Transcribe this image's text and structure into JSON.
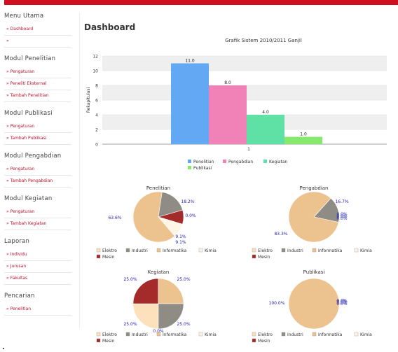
{
  "sidebar": {
    "sections": [
      {
        "title": "Menu Utama",
        "items": [
          "Dashboard",
          ""
        ]
      },
      {
        "title": "Modul Penelitian",
        "items": [
          "Pengaturan",
          "Peneliti Eksternal",
          "Tambah Penelitian"
        ]
      },
      {
        "title": "Modul Publikasi",
        "items": [
          "Pengaturan",
          "Tambah Publikasi"
        ]
      },
      {
        "title": "Modul Pengabdian",
        "items": [
          "Pengaturan",
          "Tambah Pengabdian"
        ]
      },
      {
        "title": "Modul Kegiatan",
        "items": [
          "Pengaturan",
          "Tambah Kegiatan"
        ]
      },
      {
        "title": "Laporan",
        "items": [
          "Individu",
          "Jurusan",
          "Fakultas"
        ]
      },
      {
        "title": "Pencarian",
        "items": [
          "Penelitian"
        ]
      }
    ]
  },
  "page": {
    "title": "Dashboard"
  },
  "colors": {
    "accent": "#d01020",
    "link": "#c0102a"
  },
  "chart_data": [
    {
      "type": "bar",
      "title": "Grafik Sistem 2010/2011 Ganjil",
      "xlabel": "",
      "ylabel": "Rekapitulasi",
      "categories": [
        "1"
      ],
      "ylim": [
        0,
        12
      ],
      "yticks": [
        "0",
        "2",
        "4",
        "6",
        "8",
        "10",
        "12"
      ],
      "series": [
        {
          "name": "Penelitian",
          "values": [
            11.0
          ],
          "label": "11.0",
          "color": "#62a8f2"
        },
        {
          "name": "Pengabdian",
          "values": [
            8.0
          ],
          "label": "8.0",
          "color": "#f082b8"
        },
        {
          "name": "Kegiatan",
          "values": [
            4.0
          ],
          "label": "4.0",
          "color": "#5fe0a4"
        },
        {
          "name": "Publikasi",
          "values": [
            1.0
          ],
          "label": "1.0",
          "color": "#86e86c"
        }
      ],
      "grid": true,
      "legend": "bottom"
    },
    {
      "type": "pie",
      "title": "Penelitian",
      "categories": [
        "Elektro",
        "Industri",
        "Informatika",
        "Kimia",
        "Mesin"
      ],
      "values": [
        0.0,
        18.2,
        63.6,
        9.1,
        9.1
      ],
      "labels": [
        "0.0%",
        "18.2%",
        "63.6%",
        "9.1%",
        "9.1%"
      ],
      "colors": [
        "#fde0bc",
        "#8e8c84",
        "#ecc28e",
        "#fff5e6",
        "#a52a2a"
      ],
      "legend": "bottom"
    },
    {
      "type": "pie",
      "title": "Pengabdian",
      "categories": [
        "Elektro",
        "Industri",
        "Informatika",
        "Kimia",
        "Mesin"
      ],
      "values": [
        0.0,
        16.7,
        83.3,
        0.0,
        0.0
      ],
      "labels": [
        "0.0%",
        "16.7%",
        "83.3%",
        "0.0%",
        "0.0%"
      ],
      "colors": [
        "#fde0bc",
        "#8e8c84",
        "#ecc28e",
        "#fff5e6",
        "#a52a2a"
      ],
      "legend": "bottom"
    },
    {
      "type": "pie",
      "title": "Kegiatan",
      "categories": [
        "Elektro",
        "Industri",
        "Informatika",
        "Kimia",
        "Mesin"
      ],
      "values": [
        25.0,
        25.0,
        25.0,
        0.0,
        25.0
      ],
      "labels": [
        "25.0%",
        "25.0%",
        "25.0%",
        "0.0%",
        "25.0%"
      ],
      "colors": [
        "#fde0bc",
        "#8e8c84",
        "#ecc28e",
        "#fff5e6",
        "#a52a2a"
      ],
      "legend": "bottom"
    },
    {
      "type": "pie",
      "title": "Publikasi",
      "categories": [
        "Elektro",
        "Industri",
        "Informatika",
        "Kimia",
        "Mesin"
      ],
      "values": [
        0.0,
        0.0,
        100.0,
        0.0,
        0.0
      ],
      "labels": [
        "0.0%",
        "0.0%",
        "100.0%",
        "0.0%",
        "0.0%"
      ],
      "colors": [
        "#fde0bc",
        "#8e8c84",
        "#ecc28e",
        "#fff5e6",
        "#a52a2a"
      ],
      "legend": "bottom"
    }
  ]
}
